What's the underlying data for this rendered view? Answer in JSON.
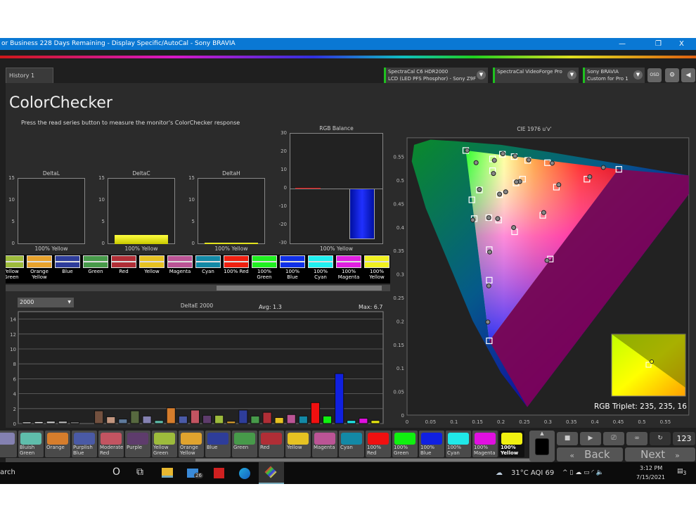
{
  "window": {
    "title": "or Business 228 Days Remaining  - Display Specific/AutoCal - Sony BRAVIA",
    "minimize": "—",
    "maximize": "❐",
    "close": "X"
  },
  "tabs": [
    {
      "label": "History 1"
    }
  ],
  "devices": [
    {
      "line1": "SpectraCal C6 HDR2000",
      "line2": "LCD (LED PFS Phosphor) - Sony Z9F"
    },
    {
      "line1": "SpectraCal VideoForge Pro",
      "line2": ""
    },
    {
      "line1": "Sony BRAVIA",
      "line2": "Custom for Pro 1"
    }
  ],
  "toolbar": {
    "osd": "OSD",
    "settings": "⚙",
    "collapse": "◀"
  },
  "page": {
    "title": "ColorChecker",
    "subtitle": "Press the read series button to measure the monitor's ColorChecker response"
  },
  "small_charts": [
    {
      "title": "DeltaL",
      "label": "100% Yellow",
      "ticks": [
        "15",
        "10",
        "5",
        "0"
      ],
      "value": 0.0,
      "max": 15
    },
    {
      "title": "DeltaC",
      "label": "100% Yellow",
      "ticks": [
        "15",
        "10",
        "5",
        "0"
      ],
      "value": 2.2,
      "max": 15
    },
    {
      "title": "DeltaH",
      "label": "100% Yellow",
      "ticks": [
        "15",
        "10",
        "5",
        "0"
      ],
      "value": 0.3,
      "max": 15
    }
  ],
  "rgb_balance": {
    "title": "RGB Balance",
    "label": "100% Yellow",
    "ticks": [
      "30",
      "20",
      "10",
      "0",
      "-10",
      "-20",
      "-30"
    ],
    "red": 0.2,
    "green": -0.3,
    "blue": -27.5
  },
  "top_swatches": [
    {
      "label": "Yellow Green",
      "color": "#9dbb3c"
    },
    {
      "label": "Orange Yellow",
      "color": "#e7a22c"
    },
    {
      "label": "Blue",
      "color": "#2e3d9a"
    },
    {
      "label": "Green",
      "color": "#479a4a"
    },
    {
      "label": "Red",
      "color": "#b02e36"
    },
    {
      "label": "Yellow",
      "color": "#e6c222"
    },
    {
      "label": "Magenta",
      "color": "#bb5495"
    },
    {
      "label": "Cyan",
      "color": "#1389a6"
    },
    {
      "label": "100% Red",
      "color": "#f02010"
    },
    {
      "label": "100% Green",
      "color": "#20f020"
    },
    {
      "label": "100% Blue",
      "color": "#1030e8"
    },
    {
      "label": "100% Cyan",
      "color": "#20f0f0"
    },
    {
      "label": "100% Magenta",
      "color": "#e020e0"
    },
    {
      "label": "100% Yellow",
      "color": "#f0f020"
    }
  ],
  "deltae": {
    "dropdown": "2000",
    "title": "DeltaE 2000",
    "avg": "Avg: 1.3",
    "max": "Max: 6.7"
  },
  "chart_data": [
    {
      "type": "bar",
      "title": "DeltaE 2000",
      "ylim": [
        0,
        15
      ],
      "yticks": [
        "0",
        "2",
        "4",
        "6",
        "8",
        "10",
        "12",
        "14"
      ],
      "values": [
        0.2,
        0.25,
        0.3,
        0.3,
        0.2,
        0,
        1.7,
        0.9,
        0.6,
        1.7,
        1.0,
        0.4,
        2.1,
        1.0,
        1.8,
        1.1,
        1.1,
        0.3,
        1.8,
        1.0,
        1.5,
        0.8,
        1.2,
        1.0,
        2.8,
        1.0,
        6.7,
        0.4,
        0.7,
        0.4
      ],
      "colors": [
        "#eeeeee",
        "#dddddd",
        "#cccccc",
        "#bbbbbb",
        "#999999",
        "#222222",
        "#73513f",
        "#c2967f",
        "#5f7a9b",
        "#57693f",
        "#8481b1",
        "#5fbdab",
        "#d67d2c",
        "#4a5aa6",
        "#c25461",
        "#5e3c6c",
        "#9dbb3c",
        "#e0a32e",
        "#2e3d9a",
        "#479a4a",
        "#b02e36",
        "#e6c222",
        "#bb5495",
        "#1389a6",
        "#f01010",
        "#10f010",
        "#1020e0",
        "#20e8e8",
        "#e010e0",
        "#e8e810"
      ]
    },
    {
      "type": "scatter",
      "title": "CIE 1976 u'v'",
      "xlim": [
        0,
        0.6
      ],
      "ylim": [
        0,
        0.59
      ],
      "xticks": [
        "0",
        "0.05",
        "0.1",
        "0.15",
        "0.2",
        "0.25",
        "0.3",
        "0.35",
        "0.4",
        "0.45",
        "0.5",
        "0.55"
      ],
      "yticks": [
        "0",
        "0.05",
        "0.1",
        "0.15",
        "0.2",
        "0.25",
        "0.3",
        "0.35",
        "0.4",
        "0.45",
        "0.5",
        "0.55"
      ],
      "targets": [
        [
          0.125,
          0.563
        ],
        [
          0.451,
          0.523
        ],
        [
          0.175,
          0.158
        ],
        [
          0.203,
          0.555
        ],
        [
          0.228,
          0.55
        ],
        [
          0.257,
          0.542
        ],
        [
          0.299,
          0.537
        ],
        [
          0.383,
          0.502
        ],
        [
          0.318,
          0.485
        ],
        [
          0.246,
          0.502
        ],
        [
          0.232,
          0.494
        ],
        [
          0.182,
          0.545
        ],
        [
          0.182,
          0.52
        ],
        [
          0.154,
          0.479
        ],
        [
          0.138,
          0.458
        ],
        [
          0.197,
          0.469
        ],
        [
          0.143,
          0.418
        ],
        [
          0.174,
          0.42
        ],
        [
          0.195,
          0.415
        ],
        [
          0.289,
          0.425
        ],
        [
          0.229,
          0.39
        ],
        [
          0.175,
          0.352
        ],
        [
          0.305,
          0.332
        ],
        [
          0.175,
          0.287
        ]
      ],
      "measured": [
        [
          0.128,
          0.563
        ],
        [
          0.418,
          0.527
        ],
        [
          0.172,
          0.198
        ],
        [
          0.204,
          0.556
        ],
        [
          0.23,
          0.551
        ],
        [
          0.259,
          0.543
        ],
        [
          0.309,
          0.536
        ],
        [
          0.389,
          0.507
        ],
        [
          0.323,
          0.49
        ],
        [
          0.24,
          0.497
        ],
        [
          0.233,
          0.496
        ],
        [
          0.186,
          0.542
        ],
        [
          0.184,
          0.514
        ],
        [
          0.154,
          0.48
        ],
        [
          0.147,
          0.537
        ],
        [
          0.197,
          0.47
        ],
        [
          0.21,
          0.475
        ],
        [
          0.14,
          0.415
        ],
        [
          0.174,
          0.42
        ],
        [
          0.193,
          0.418
        ],
        [
          0.291,
          0.431
        ],
        [
          0.227,
          0.399
        ],
        [
          0.176,
          0.347
        ],
        [
          0.298,
          0.329
        ],
        [
          0.174,
          0.275
        ]
      ],
      "inset_label": "RGB Triplet: 235, 235, 16"
    }
  ],
  "bottom_swatches": [
    {
      "label": "er",
      "color": "#8481b1"
    },
    {
      "label": "Bluish Green",
      "color": "#5fbdab"
    },
    {
      "label": "Orange",
      "color": "#d67d2c"
    },
    {
      "label": "Purplish Blue",
      "color": "#4a5aa6"
    },
    {
      "label": "Moderate Red",
      "color": "#c25461"
    },
    {
      "label": "Purple",
      "color": "#5e3c6c"
    },
    {
      "label": "Yellow Green",
      "color": "#9dbb3c"
    },
    {
      "label": "Orange Yellow",
      "color": "#e0a32e"
    },
    {
      "label": "Blue",
      "color": "#2e3d9a"
    },
    {
      "label": "Green",
      "color": "#479a4a"
    },
    {
      "label": "Red",
      "color": "#b02e36"
    },
    {
      "label": "Yellow",
      "color": "#e6c222"
    },
    {
      "label": "Magenta",
      "color": "#bb5495"
    },
    {
      "label": "Cyan",
      "color": "#1389a6"
    },
    {
      "label": "100% Red",
      "color": "#f01010"
    },
    {
      "label": "100% Green",
      "color": "#10f010"
    },
    {
      "label": "100% Blue",
      "color": "#1020e0"
    },
    {
      "label": "100% Cyan",
      "color": "#20e8e8"
    },
    {
      "label": "100% Magenta",
      "color": "#e010e0"
    },
    {
      "label": "100% Yellow",
      "color": "#f0f010",
      "selected": true
    }
  ],
  "controls": {
    "up": "▲",
    "stop": "■",
    "play": "▶",
    "save": "⎚",
    "loop": "∞",
    "refresh": "↻",
    "counter": "123",
    "back": "Back",
    "next": "Next",
    "back_icon": "«",
    "next_icon": "»"
  },
  "taskbar": {
    "search": "arch",
    "cortana": "O",
    "taskview": "⧉",
    "mail_badge": "26",
    "weather": "31°C  AQI 69",
    "tray": "^  ▯  ☁  ▭  ◜  🔈",
    "time": "3:12 PM",
    "date": "7/15/2021",
    "notif": "3"
  }
}
